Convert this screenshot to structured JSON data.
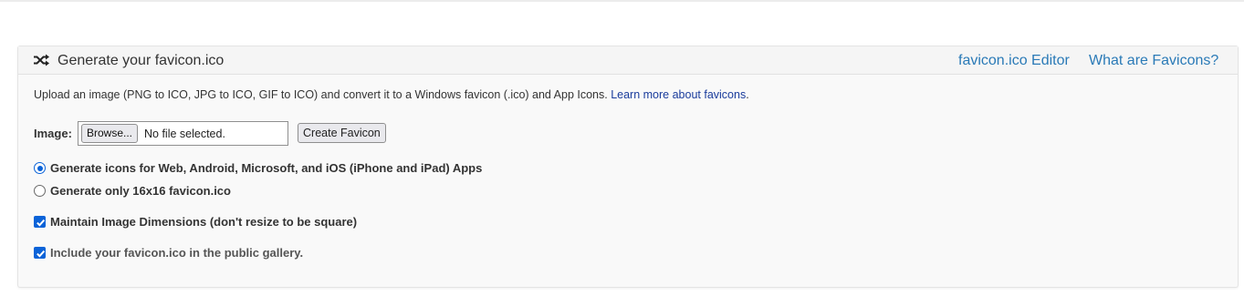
{
  "panel": {
    "title": "Generate your favicon.ico",
    "icon": "shuffle-icon",
    "links": {
      "editor": "favicon.ico Editor",
      "what": "What are Favicons?"
    }
  },
  "intro": {
    "text": "Upload an image (PNG to ICO, JPG to ICO, GIF to ICO) and convert it to a Windows favicon (.ico) and App Icons. ",
    "link": "Learn more about favicons",
    "suffix": "."
  },
  "image_field": {
    "label": "Image:",
    "browse_label": "Browse...",
    "file_status": "No file selected.",
    "create_label": "Create Favicon"
  },
  "options": {
    "radio_all": {
      "label": "Generate icons for Web, Android, Microsoft, and iOS (iPhone and iPad) Apps",
      "selected": true
    },
    "radio_16": {
      "label": "Generate only 16x16 favicon.ico",
      "selected": false
    },
    "maintain_dims": {
      "label": "Maintain Image Dimensions (don't resize to be square)",
      "checked": true
    },
    "public_gallery": {
      "label": "Include your favicon.ico in the public gallery.",
      "checked": true
    }
  },
  "colors": {
    "accent": "#0b63d8",
    "link": "#2a7ab7",
    "panel_bg": "#f9f9f9"
  }
}
